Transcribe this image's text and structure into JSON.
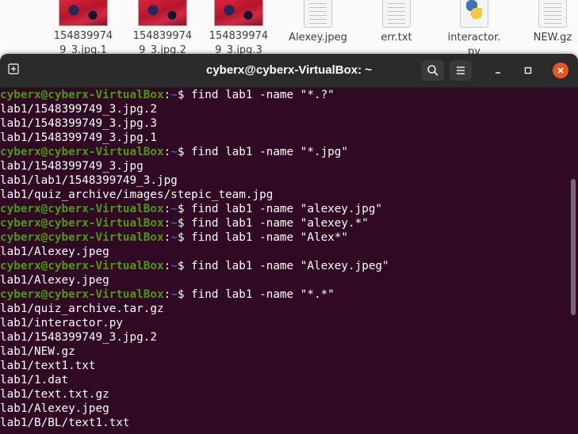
{
  "file_manager": {
    "files": [
      {
        "name": "154839974\n9_3.jpg.1",
        "kind": "image"
      },
      {
        "name": "154839974\n9_3.jpg.2",
        "kind": "image"
      },
      {
        "name": "154839974\n9_3.jpg.3",
        "kind": "image"
      },
      {
        "name": "Alexey.jpeg",
        "kind": "document"
      },
      {
        "name": "err.txt",
        "kind": "document"
      },
      {
        "name": "interactor.\npy",
        "kind": "python"
      },
      {
        "name": "NEW.gz",
        "kind": "document"
      }
    ]
  },
  "terminal": {
    "title": "cyberx@cyberx-VirtualBox: ~",
    "prompt_user": "cyberx@cyberx-VirtualBox",
    "prompt_sep": ":",
    "prompt_path": "~",
    "prompt_end": "$ ",
    "colors": {
      "background": "#300a24",
      "prompt_user": "#4e9a06",
      "prompt_path": "#3465a4",
      "close_button": "#e95420"
    },
    "lines": [
      {
        "type": "cmd",
        "text": "find lab1 -name \"*.?\""
      },
      {
        "type": "out",
        "text": "lab1/1548399749_3.jpg.2"
      },
      {
        "type": "out",
        "text": "lab1/1548399749_3.jpg.3"
      },
      {
        "type": "out",
        "text": "lab1/1548399749_3.jpg.1"
      },
      {
        "type": "cmd",
        "text": "find lab1 -name \"*.jpg\""
      },
      {
        "type": "out",
        "text": "lab1/1548399749_3.jpg"
      },
      {
        "type": "out",
        "text": "lab1/lab1/1548399749_3.jpg"
      },
      {
        "type": "out",
        "text": "lab1/quiz_archive/images/stepic_team.jpg"
      },
      {
        "type": "cmd",
        "text": "find lab1 -name \"alexey.jpg\""
      },
      {
        "type": "cmd",
        "text": "find lab1 -name \"alexey.*\""
      },
      {
        "type": "cmd",
        "text": "find lab1 -name \"Alex*\""
      },
      {
        "type": "out",
        "text": "lab1/Alexey.jpeg"
      },
      {
        "type": "cmd",
        "text": "find lab1 -name \"Alexey.jpeg\""
      },
      {
        "type": "out",
        "text": "lab1/Alexey.jpeg"
      },
      {
        "type": "cmd",
        "text": "find lab1 -name \"*.*\""
      },
      {
        "type": "out",
        "text": "lab1/quiz_archive.tar.gz"
      },
      {
        "type": "out",
        "text": "lab1/interactor.py"
      },
      {
        "type": "out",
        "text": "lab1/1548399749_3.jpg.2"
      },
      {
        "type": "out",
        "text": "lab1/NEW.gz"
      },
      {
        "type": "out",
        "text": "lab1/text1.txt"
      },
      {
        "type": "out",
        "text": "lab1/1.dat"
      },
      {
        "type": "out",
        "text": "lab1/text.txt.gz"
      },
      {
        "type": "out",
        "text": "lab1/Alexey.jpeg"
      },
      {
        "type": "out",
        "text": "lab1/B/BL/text1.txt"
      }
    ]
  },
  "icons": {
    "new_tab": "new-tab-icon",
    "search": "search-icon",
    "menu": "hamburger-menu-icon",
    "minimize": "minimize-icon",
    "maximize": "maximize-icon",
    "close": "close-icon"
  }
}
